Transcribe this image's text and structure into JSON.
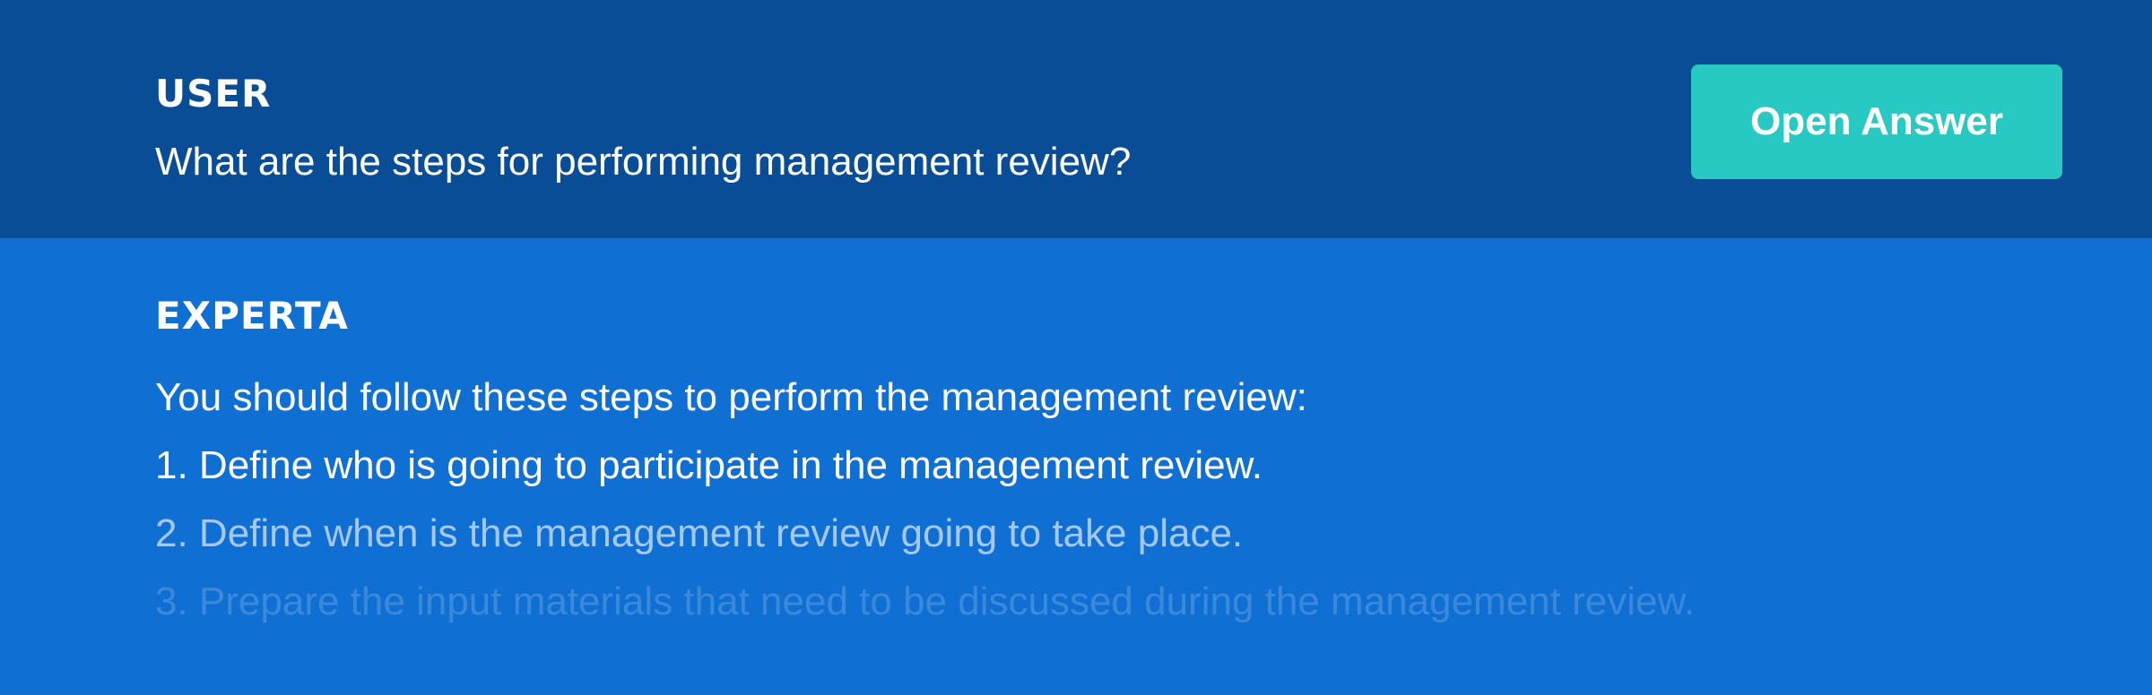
{
  "question": {
    "role": "USER",
    "text": "What are the steps for performing management review?",
    "open_answer_label": "Open Answer"
  },
  "answer": {
    "role": "EXPERTA",
    "lines": [
      "You should follow these steps to perform the management review:",
      "1. Define who is going to participate in the management review.",
      "2. Define when is the management review going to take place.",
      "3. Prepare the input materials that need to be discussed during the management review."
    ]
  },
  "colors": {
    "question_bg": "#084d96",
    "answer_bg": "#0f6fd3",
    "button_bg": "#28c8c3",
    "text": "#ffffff"
  }
}
